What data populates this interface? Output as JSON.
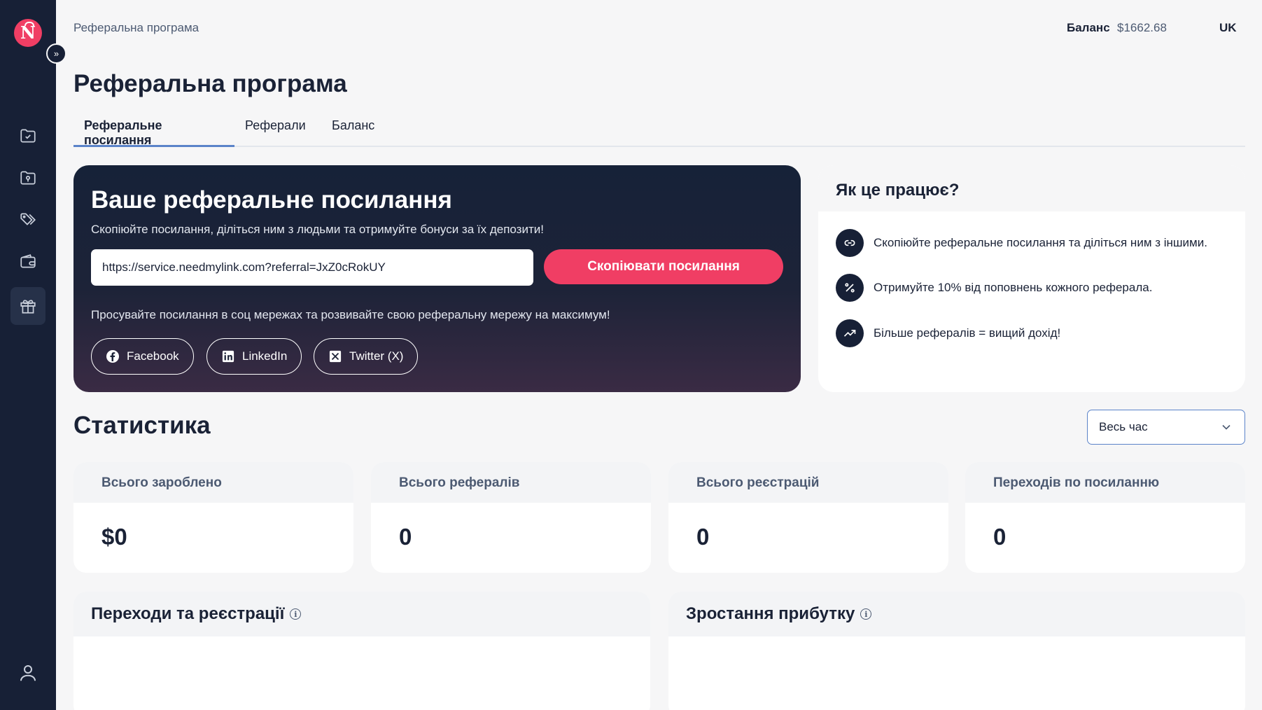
{
  "app": {
    "logo_letter": "N"
  },
  "header": {
    "breadcrumb": "Реферальна програма",
    "balance_label": "Баланс",
    "balance_value": "$1662.68",
    "language": "UK"
  },
  "page": {
    "title": "Реферальна програма"
  },
  "tabs": [
    {
      "label": "Реферальне посилання",
      "active": true
    },
    {
      "label": "Реферали",
      "active": false
    },
    {
      "label": "Баланс",
      "active": false
    }
  ],
  "referral": {
    "title": "Ваше реферальне посилання",
    "subtitle": "Скопіюйте посилання, діліться ним з людьми та отримуйте бонуси за їх депозити!",
    "link_value": "https://service.needmylink.com?referral=JxZ0cRokUY",
    "copy_button": "Скопіювати посилання",
    "promote_text": "Просувайте посилання в соц мережах та розвивайте свою реферальну мережу на максимум!",
    "social": [
      {
        "label": "Facebook",
        "icon": "facebook-icon"
      },
      {
        "label": "LinkedIn",
        "icon": "linkedin-icon"
      },
      {
        "label": "Twitter (X)",
        "icon": "x-icon"
      }
    ]
  },
  "how": {
    "title": "Як це працює?",
    "steps": [
      {
        "text": "Скопіюйте реферальне посилання та діліться ним з іншими.",
        "icon": "link-icon"
      },
      {
        "text": "Отримуйте 10% від поповнень кожного реферала.",
        "icon": "percent-icon"
      },
      {
        "text": "Більше рефералів = вищий дохід!",
        "icon": "trend-up-icon"
      }
    ]
  },
  "stats": {
    "title": "Статистика",
    "period": "Весь час",
    "cards": [
      {
        "label": "Всього зароблено",
        "value": "$0"
      },
      {
        "label": "Всього рефералів",
        "value": "0"
      },
      {
        "label": "Всього реєстрацій",
        "value": "0"
      },
      {
        "label": "Переходів по посиланню",
        "value": "0"
      }
    ]
  },
  "charts": [
    {
      "title": "Переходи та реєстрації"
    },
    {
      "title": "Зростання прибутку"
    }
  ],
  "colors": {
    "accent": "#f03e64",
    "sidebar": "#172036",
    "tab_underline": "#5b83c9"
  }
}
